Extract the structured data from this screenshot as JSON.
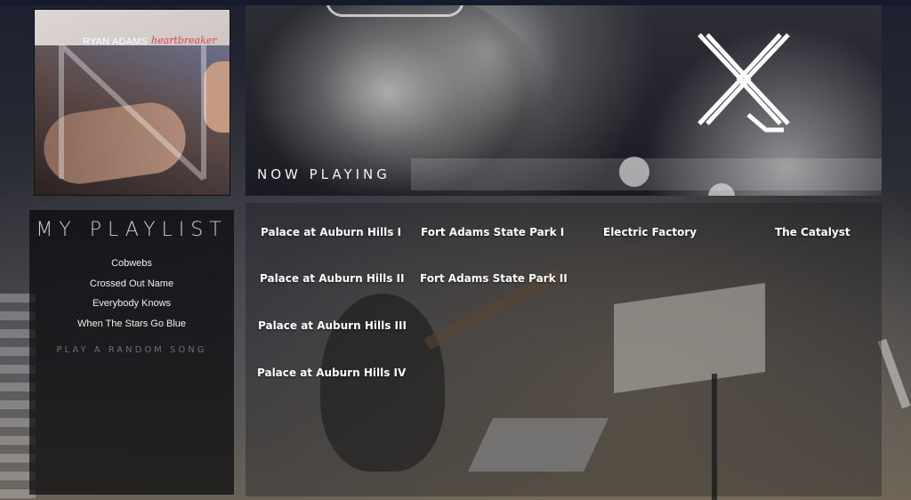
{
  "album": {
    "artist": "RYAN ADAMS",
    "title": "heartbreaker"
  },
  "now_playing": {
    "label": "NOW PLAYING",
    "progress": 0
  },
  "playlist": {
    "title": "MY PLAYLIST",
    "songs": [
      "Cobwebs",
      "Crossed Out Name",
      "Everybody Knows",
      "When The Stars Go Blue"
    ],
    "random_label": "PLAY A RANDOM SONG"
  },
  "venues": [
    [
      "Palace at Auburn Hills I",
      "Fort Adams State Park I",
      "Electric Factory",
      "The Catalyst"
    ],
    [
      "Palace at Auburn Hills II",
      "Fort Adams State Park II"
    ],
    [
      "Palace at Auburn Hills III"
    ],
    [
      "Palace at Auburn Hills IV"
    ]
  ]
}
